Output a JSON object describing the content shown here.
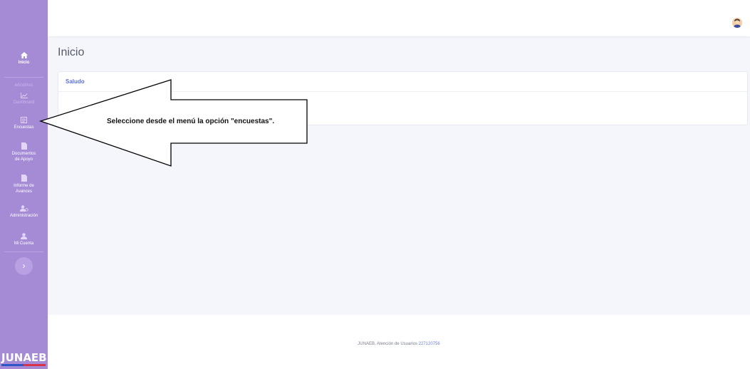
{
  "page": {
    "title": "Inicio"
  },
  "sidebar": {
    "section_heading": "edcomos",
    "items": [
      {
        "label": "Inicio",
        "icon": "home-icon"
      },
      {
        "label": "Dashboard",
        "icon": "chart-line-icon"
      },
      {
        "label": "Encuestas",
        "icon": "survey-icon"
      },
      {
        "label": "Documentos de Apoyo",
        "icon": "document-icon"
      },
      {
        "label": "Informe de Avances",
        "icon": "document-icon"
      },
      {
        "label": "Administración",
        "icon": "users-admin-icon"
      },
      {
        "label": "Mi Cuenta",
        "icon": "user-icon"
      }
    ],
    "toggle_icon": "chevron-right-icon",
    "logo_text": "JUNAEB",
    "logo_bar_colors": [
      "#2d56c8",
      "#d8334a"
    ]
  },
  "card": {
    "header": "Saludo"
  },
  "annotation": {
    "text": "Seleccione desde el menú la opción \"encuestas\"."
  },
  "footer": {
    "text": "JUNAEB, Atención de Usuarios",
    "phone": "227120756"
  },
  "colors": {
    "sidebar": "#a58bd6",
    "accent": "#5a6fd8",
    "background": "#f4f6fb"
  }
}
